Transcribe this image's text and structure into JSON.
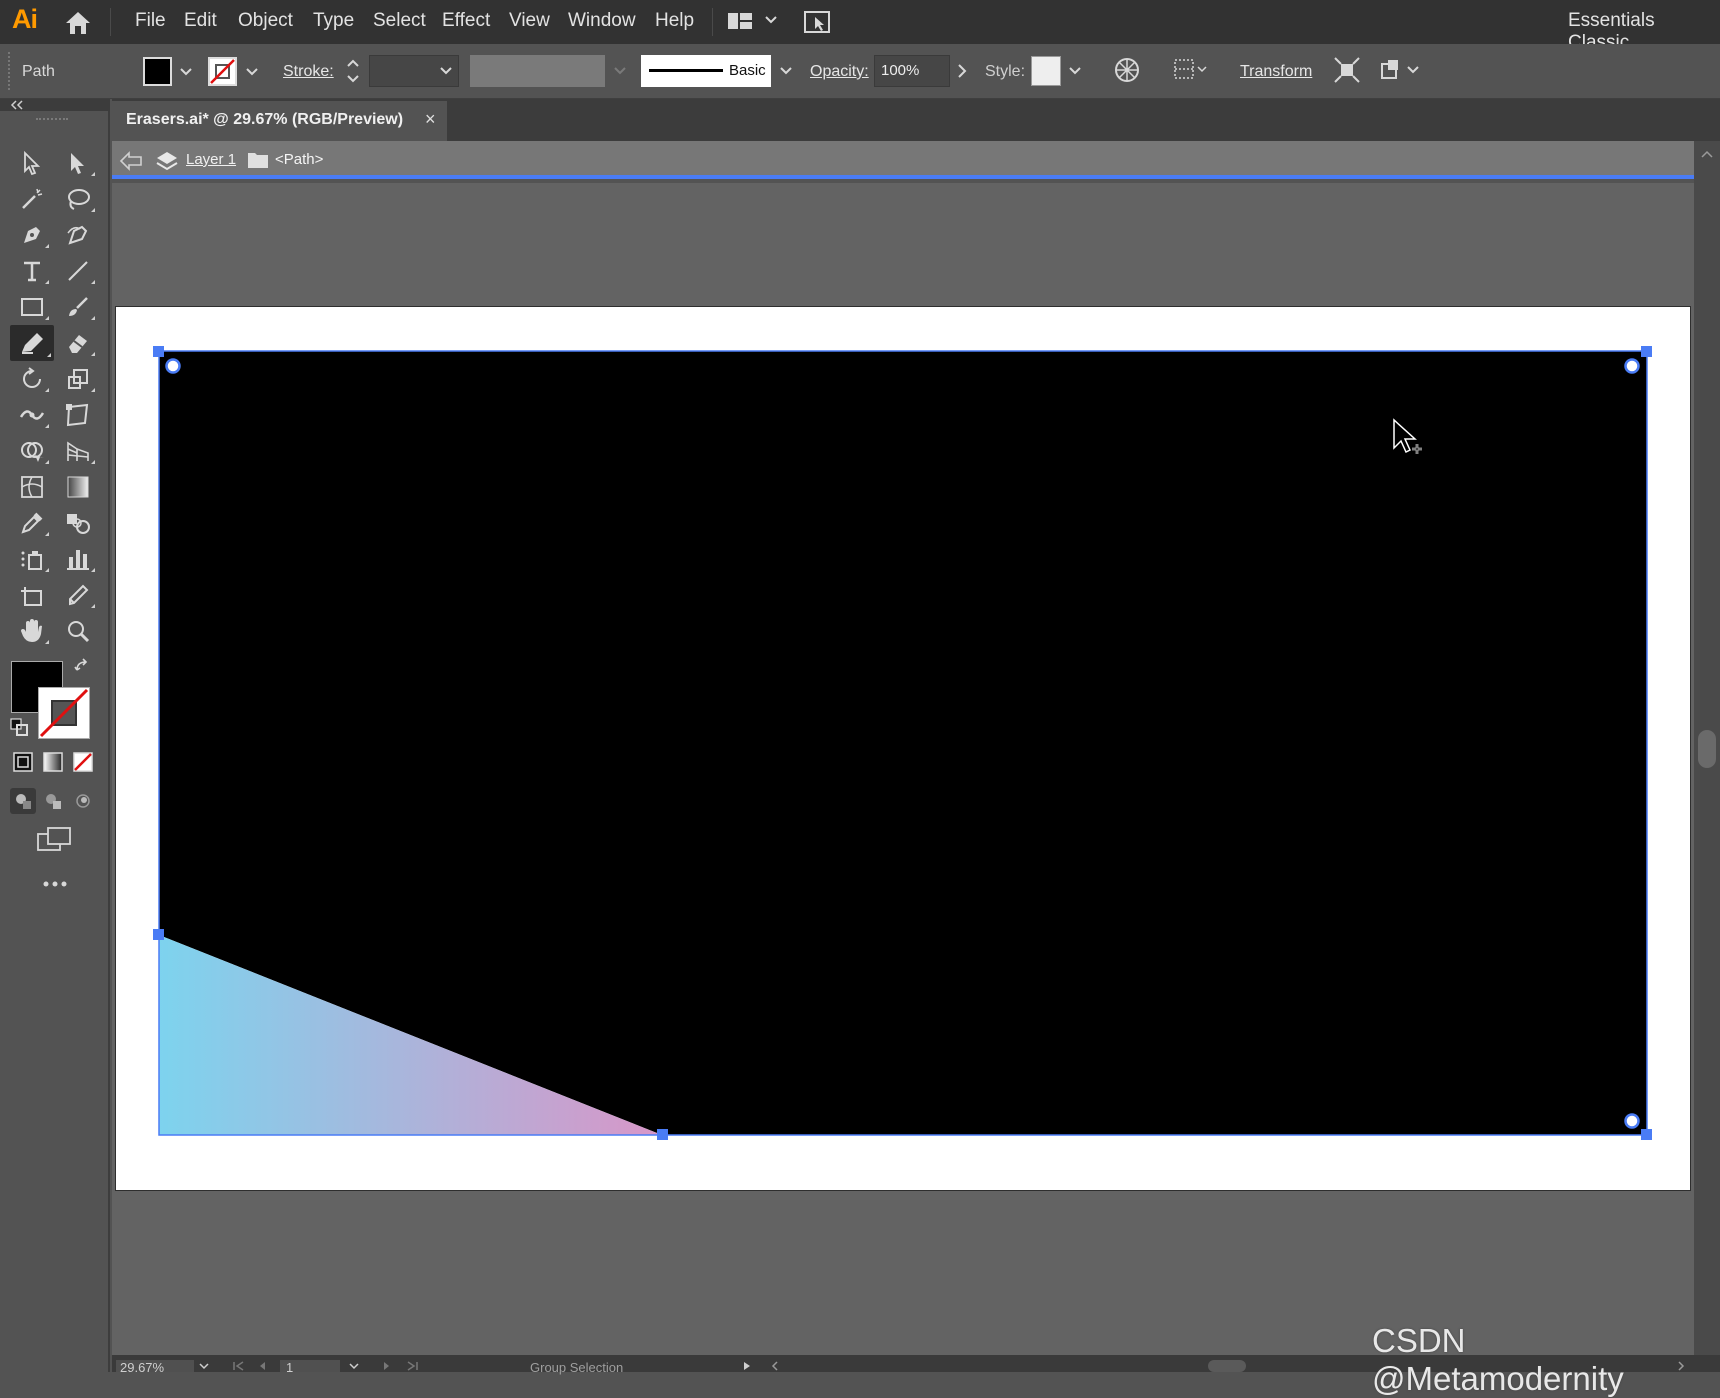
{
  "app": {
    "logo": "Ai",
    "menu": [
      "File",
      "Edit",
      "Object",
      "Type",
      "Select",
      "Effect",
      "View",
      "Window",
      "Help"
    ],
    "workspace": "Essentials Classic"
  },
  "control_bar": {
    "selection_type": "Path",
    "stroke_label": "Stroke:",
    "brush_label": "Basic",
    "opacity_label": "Opacity:",
    "opacity_value": "100%",
    "style_label": "Style:",
    "transform_label": "Transform"
  },
  "document": {
    "tab_title": "Erasers.ai* @ 29.67% (RGB/Preview)",
    "tab_close": "×",
    "breadcrumb": {
      "layer": "Layer 1",
      "path": "<Path>"
    }
  },
  "artwork": {
    "rect_color": "#000000",
    "gradient_start": "#7dd3ee",
    "gradient_end": "#d896c8",
    "selection_color": "#4a7cf5"
  },
  "status_bar": {
    "zoom": "29.67%",
    "artboard_number": "1",
    "current_tool": "Group Selection"
  },
  "watermark": "CSDN @Metamodernity"
}
